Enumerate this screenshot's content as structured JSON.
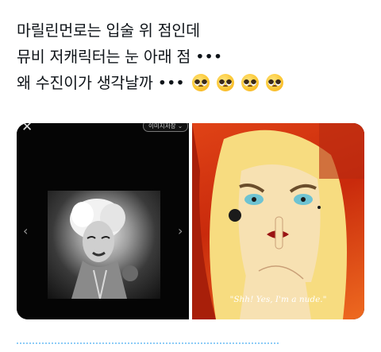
{
  "post": {
    "lines": [
      "마릴린먼로는 입술 위 점인데",
      "뮤비 저캐릭터는 눈 아래 점 •••",
      "왜 수진이가 생각날까 •••"
    ],
    "emoji": "pleading-face"
  },
  "media": {
    "left_image": {
      "overlay_button": "이미지저장 ⌄",
      "prev_arrow": "‹",
      "next_arrow": "›"
    },
    "right_image": {
      "caption": "\"Shh! Yes, I'm a nude.\""
    }
  },
  "colors": {
    "text": "#0f1419",
    "accent": "#1d9bf0",
    "right_bg": "#d2320f"
  }
}
